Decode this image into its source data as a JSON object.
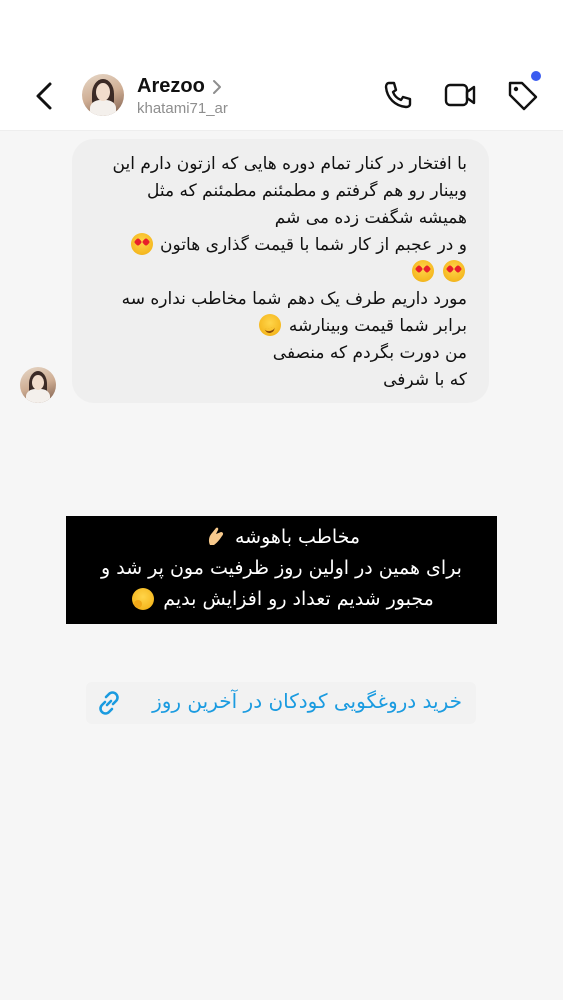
{
  "header": {
    "back_icon": "chevron-left-icon",
    "name": "Arezoo",
    "username": "khatami71_ar",
    "call_icon": "phone-icon",
    "video_icon": "video-camera-icon",
    "tag_icon": "tag-icon",
    "notification_dot_color": "#3b5cf0"
  },
  "message": {
    "lines": [
      "با افتخار در کنار تمام دوره هایی که ازتون دارم این",
      "وبینار رو هم گرفتم و مطمئنم مطمئنم که مثل",
      "همیشه شگفت زده می شم",
      "و در عجبم از کار شما با قیمت گذاری هاتون",
      "",
      "مورد داریم طرف یک دهم شما مخاطب نداره سه",
      "برابر شما قیمت وبینارشه",
      "من دورت بگردم که منصفی",
      "که با شرفی"
    ],
    "emojis": [
      "smiling-face-with-heart-eyes",
      "smirking-face"
    ],
    "bubble_color": "#efefef"
  },
  "story_caption": {
    "lines": [
      "مخاطب باهوشه",
      "برای همین در اولین روز ظرفیت مون پر شد و",
      "مجبور شدیم تعداد رو افزایش بدیم"
    ],
    "emojis": [
      "pinched-fingers-hand",
      "hugging-face"
    ],
    "background_color": "#000000",
    "text_color": "#ffffff"
  },
  "link_sticker": {
    "icon": "link-icon",
    "text": "خرید دروغگویی کودکان در آخرین روز",
    "color": "#1a9be0"
  }
}
